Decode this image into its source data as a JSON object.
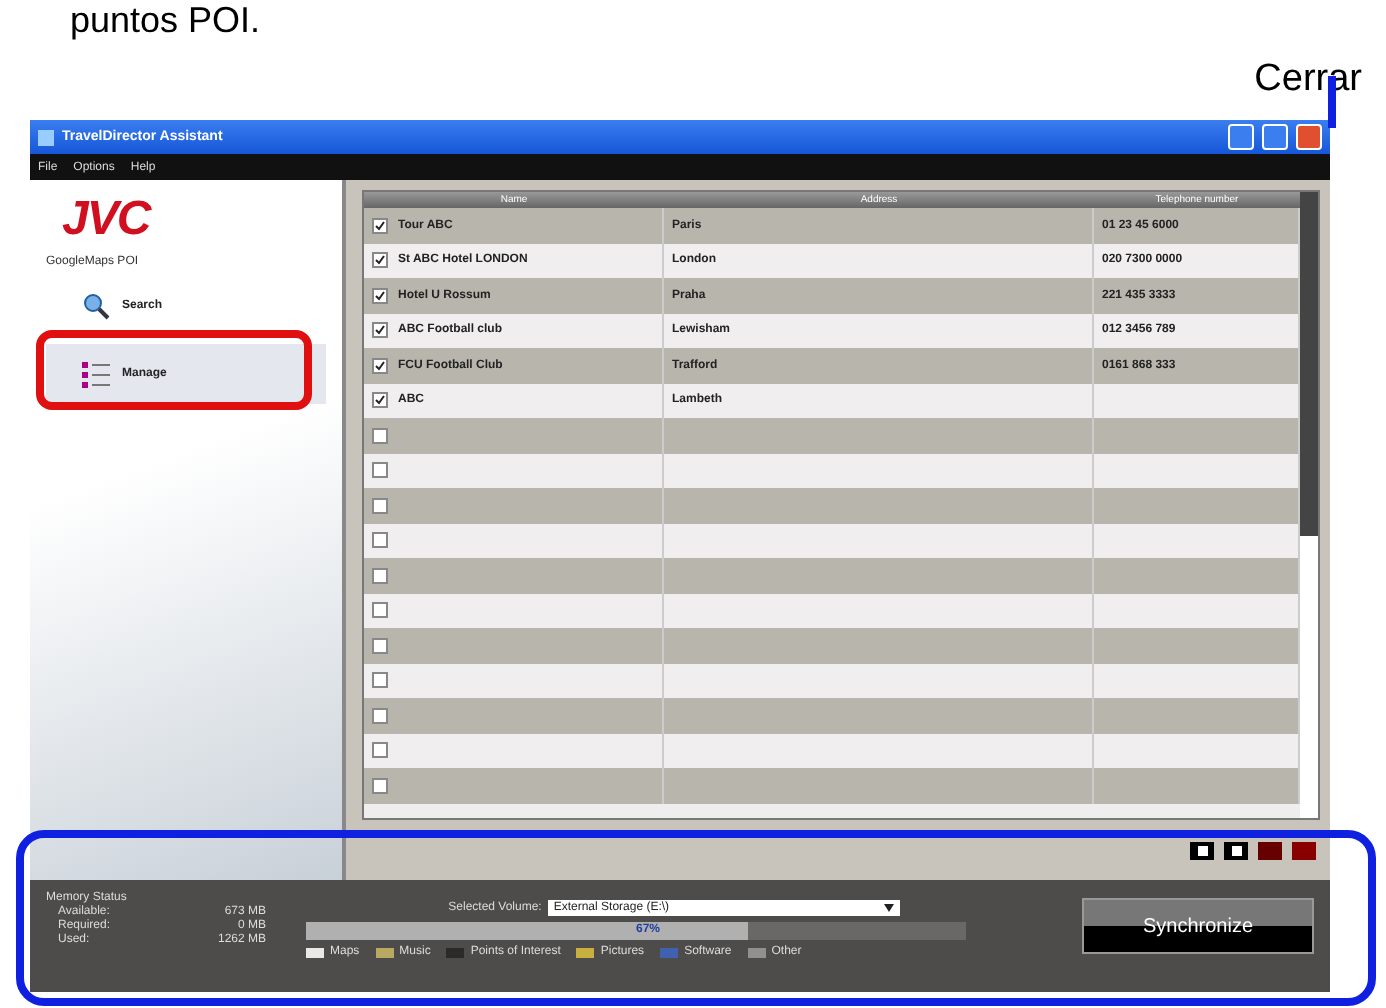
{
  "document": {
    "text": "puntos POI.",
    "close_label": "Cerrar"
  },
  "window": {
    "title": "TravelDirector Assistant"
  },
  "menu": [
    "File",
    "Options",
    "Help"
  ],
  "sidebar": {
    "logo": "JVC",
    "subtitle": "GoogleMaps POI",
    "items": [
      {
        "label": "Search",
        "kind": "search",
        "selected": false
      },
      {
        "label": "Manage",
        "kind": "manage",
        "selected": true
      }
    ]
  },
  "table": {
    "columns": [
      "Name",
      "Address",
      "Telephone number"
    ],
    "rows": [
      {
        "checked": true,
        "cells": [
          "Tour ABC",
          "Paris",
          "01 23 45 6000"
        ]
      },
      {
        "checked": true,
        "cells": [
          "St ABC Hotel LONDON",
          "London",
          "020 7300 0000"
        ]
      },
      {
        "checked": true,
        "cells": [
          "Hotel U Rossum",
          "Praha",
          "221 435 3333"
        ]
      },
      {
        "checked": true,
        "cells": [
          "ABC Football club",
          "Lewisham",
          "012 3456 789"
        ]
      },
      {
        "checked": true,
        "cells": [
          "FCU Football Club",
          "Trafford",
          "0161 868 333"
        ]
      },
      {
        "checked": true,
        "cells": [
          "ABC",
          "Lambeth"
        ]
      },
      {
        "checked": false
      },
      {
        "checked": false
      },
      {
        "checked": false
      },
      {
        "checked": false
      },
      {
        "checked": false
      },
      {
        "checked": false
      },
      {
        "checked": false
      },
      {
        "checked": false
      },
      {
        "checked": false
      },
      {
        "checked": false
      },
      {
        "checked": false
      }
    ]
  },
  "memory": {
    "title": "Memory Status",
    "rows": [
      {
        "label": "Available:",
        "value": "673 MB"
      },
      {
        "label": "Required:",
        "value": "0 MB"
      },
      {
        "label": "Used:",
        "value": "1262 MB"
      }
    ]
  },
  "volume": {
    "label": "Selected Volume:",
    "value": "External Storage (E:\\)"
  },
  "usage": {
    "level": 0.67,
    "reading": "67%"
  },
  "legend": [
    {
      "label": "Maps",
      "color": "#e8e8e8"
    },
    {
      "label": "Music",
      "color": "#b8a860"
    },
    {
      "label": "Points of Interest",
      "color": "#2a2a2a"
    },
    {
      "label": "Pictures",
      "color": "#c8b040"
    },
    {
      "label": "Software",
      "color": "#4060b0"
    },
    {
      "label": "Other",
      "color": "#909090"
    }
  ],
  "sync_button": "Synchronize"
}
